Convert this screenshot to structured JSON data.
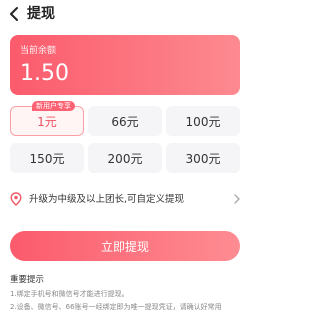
{
  "nav": {
    "title": "提现"
  },
  "balance": {
    "label": "当前余额",
    "value": "1.50"
  },
  "amounts": {
    "badge": "新用户专享",
    "options": [
      "1元",
      "66元",
      "100元",
      "150元",
      "200元",
      "300元"
    ],
    "selected_index": 0
  },
  "upgrade": {
    "text": "升级为中级及以上团长,可自定义提现"
  },
  "withdraw_button": {
    "label": "立即提现"
  },
  "tips": {
    "title": "重要提示",
    "items": [
      "1.绑定手机号和微信号才能进行提现。",
      "2.设备、微信号、66账号一经绑定即为唯一提现凭证，请确认好常用"
    ]
  },
  "colors": {
    "accent": "#fb5b6c",
    "accent_light": "#fd8a90"
  }
}
